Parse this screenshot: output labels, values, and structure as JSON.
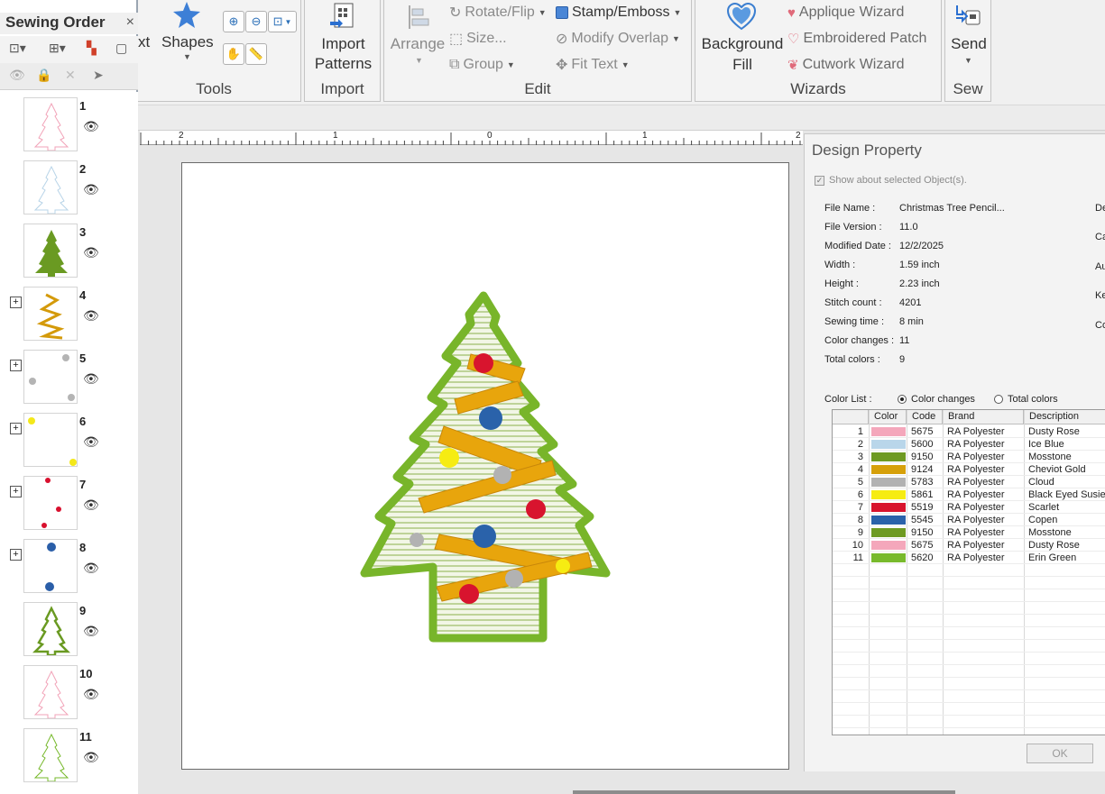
{
  "ribbon": {
    "cut_text": "xt",
    "shapes_label": "Shapes",
    "groups": {
      "tools": "Tools",
      "import": "Import",
      "edit": "Edit",
      "wizards": "Wizards",
      "sew": "Sew"
    },
    "import": {
      "line1": "Import",
      "line2": "Patterns"
    },
    "edit": {
      "arrange": "Arrange",
      "rotate_flip": "Rotate/Flip",
      "size": "Size...",
      "group": "Group",
      "stamp_emboss": "Stamp/Emboss",
      "modify_overlap": "Modify Overlap",
      "fit_text": "Fit Text"
    },
    "wizards": {
      "background": "Background",
      "fill": "Fill",
      "applique": "Applique Wizard",
      "embroidered_patch": "Embroidered Patch",
      "cutwork": "Cutwork Wizard"
    },
    "sew": {
      "send": "Send"
    }
  },
  "sewing_order": {
    "title": "Sewing Order",
    "close": "×",
    "items": [
      {
        "num": "1",
        "color": "#f2a3b8"
      },
      {
        "num": "2",
        "color": "#b8d4e8"
      },
      {
        "num": "3",
        "color": "#6a9a22"
      },
      {
        "num": "4",
        "color": "#d49a0a"
      },
      {
        "num": "5",
        "color": "#b4b4b4"
      },
      {
        "num": "6",
        "color": "#f4e81a"
      },
      {
        "num": "7",
        "color": "#d8102e"
      },
      {
        "num": "8",
        "color": "#2a5ea8"
      },
      {
        "num": "9",
        "color": "#6a9a22"
      },
      {
        "num": "10",
        "color": "#f2a3b8"
      },
      {
        "num": "11",
        "color": "#76b82a"
      }
    ]
  },
  "ruler": {
    "labels": [
      "2",
      "1",
      "0",
      "1",
      "2"
    ]
  },
  "design_property": {
    "title": "Design Property",
    "show_selected": "Show about selected Object(s).",
    "properties": [
      {
        "label": "File Name :",
        "value": "Christmas Tree Pencil..."
      },
      {
        "label": "File Version :",
        "value": "11.0"
      },
      {
        "label": "Modified Date :",
        "value": "12/2/2025"
      },
      {
        "label": "Width :",
        "value": "1.59 inch"
      },
      {
        "label": "Height :",
        "value": "2.23 inch"
      },
      {
        "label": "Stitch count :",
        "value": "4201"
      },
      {
        "label": "Sewing time :",
        "value": "8 min"
      },
      {
        "label": "Color changes :",
        "value": "11"
      },
      {
        "label": "Total colors :",
        "value": "9"
      }
    ],
    "right_cut": [
      "De",
      "Ca",
      "Au",
      "Ke",
      "Co"
    ],
    "color_list_label": "Color List :",
    "radio_color_changes": "Color changes",
    "radio_total_colors": "Total colors",
    "columns": [
      "Color",
      "Code",
      "Brand",
      "Description"
    ],
    "rows": [
      {
        "num": "1",
        "color": "#f4a7bb",
        "code": "5675",
        "brand": "RA Polyester",
        "desc": "Dusty Rose"
      },
      {
        "num": "2",
        "color": "#b9d6ea",
        "code": "5600",
        "brand": "RA Polyester",
        "desc": "Ice Blue"
      },
      {
        "num": "3",
        "color": "#6e9a22",
        "code": "9150",
        "brand": "RA Polyester",
        "desc": "Mosstone"
      },
      {
        "num": "4",
        "color": "#d6a00a",
        "code": "9124",
        "brand": "RA Polyester",
        "desc": "Cheviot Gold"
      },
      {
        "num": "5",
        "color": "#b2b2b2",
        "code": "5783",
        "brand": "RA Polyester",
        "desc": "Cloud"
      },
      {
        "num": "6",
        "color": "#f6ec12",
        "code": "5861",
        "brand": "RA Polyester",
        "desc": "Black Eyed Susie"
      },
      {
        "num": "7",
        "color": "#d8142e",
        "code": "5519",
        "brand": "RA Polyester",
        "desc": "Scarlet"
      },
      {
        "num": "8",
        "color": "#2a62aa",
        "code": "5545",
        "brand": "RA Polyester",
        "desc": "Copen"
      },
      {
        "num": "9",
        "color": "#6e9a22",
        "code": "9150",
        "brand": "RA Polyester",
        "desc": "Mosstone"
      },
      {
        "num": "10",
        "color": "#f4a7bb",
        "code": "5675",
        "brand": "RA Polyester",
        "desc": "Dusty Rose"
      },
      {
        "num": "11",
        "color": "#78ba2c",
        "code": "5620",
        "brand": "RA Polyester",
        "desc": "Erin Green"
      }
    ],
    "ok": "OK"
  }
}
